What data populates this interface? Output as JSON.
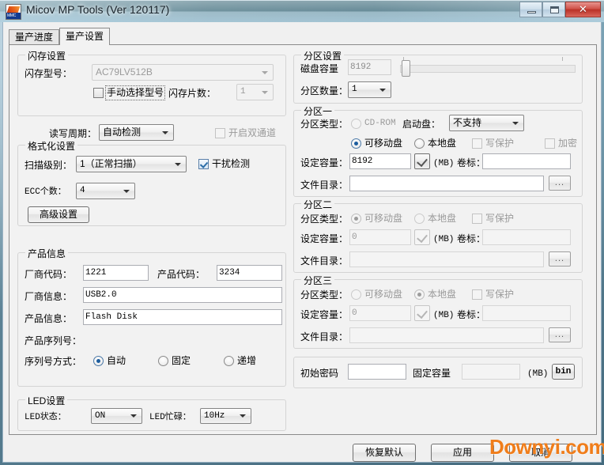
{
  "window": {
    "title": "Micov MP Tools (Ver 120117)",
    "icon": "app-icon",
    "minimize_label": "",
    "maximize_label": "",
    "close_label": "✕"
  },
  "tabs": [
    {
      "label": "量产进度",
      "active": false
    },
    {
      "label": "量产设置",
      "active": true
    }
  ],
  "flash_settings": {
    "title": "闪存设置",
    "model_label": "闪存型号：",
    "model_value": "AC79LV512B",
    "manual_select_label": "手动选择型号",
    "manual_select_checked": false,
    "chip_count_label": "闪存片数：",
    "chip_count_value": "1",
    "rw_cycle_label": "读写周期：",
    "rw_cycle_value": "自动检测",
    "dual_channel_label": "开启双通道",
    "dual_channel_checked": false
  },
  "format_settings": {
    "title": "格式化设置",
    "scan_level_label": "扫描级别：",
    "scan_level_value": "1（正常扫描）",
    "interference_label": "干扰检测",
    "interference_checked": true,
    "ecc_label": "ECC个数：",
    "ecc_value": "4",
    "advanced_button": "高级设置"
  },
  "product_info": {
    "title": "产品信息",
    "vendor_code_label": "厂商代码：",
    "vendor_code_value": "1221",
    "product_code_label": "产品代码：",
    "product_code_value": "3234",
    "vendor_info_label": "厂商信息：",
    "vendor_info_value": "USB2.0",
    "product_info_label": "产品信息：",
    "product_info_value": "Flash Disk",
    "serial_title_label": "产品序列号：",
    "serial_mode_label": "序列号方式：",
    "serial_modes": [
      {
        "label": "自动",
        "selected": true
      },
      {
        "label": "固定",
        "selected": false
      },
      {
        "label": "递增",
        "selected": false
      }
    ]
  },
  "led_settings": {
    "title": "LED设置",
    "state_label": "LED状态：",
    "state_value": "ON",
    "busy_label": "LED忙碌：",
    "busy_value": "10Hz"
  },
  "partition_settings": {
    "title": "分区设置",
    "disk_capacity_label": "磁盘容量",
    "disk_capacity_value": "8192",
    "partition_count_label": "分区数量：",
    "partition_count_value": "1",
    "slider_position_pct": 0
  },
  "partition_one": {
    "title": "分区一",
    "type_label": "分区类型：",
    "cdrom_label": "CD-ROM",
    "cdrom_selected": false,
    "boot_label": "启动盘：",
    "boot_value": "不支持",
    "removable_label": "可移动盘",
    "removable_selected": true,
    "local_label": "本地盘",
    "local_selected": false,
    "write_protect_label": "写保护",
    "write_protect_checked": false,
    "encrypt_label": "加密",
    "encrypt_checked": false,
    "capacity_label": "设定容量：",
    "capacity_value": "8192",
    "unit_label": "(MB)",
    "volume_label": "卷标：",
    "volume_value": "",
    "dir_label": "文件目录：",
    "dir_value": "",
    "browse_label": "..."
  },
  "partition_two": {
    "title": "分区二",
    "type_label": "分区类型：",
    "removable_label": "可移动盘",
    "removable_selected": true,
    "local_label": "本地盘",
    "local_selected": false,
    "write_protect_label": "写保护",
    "write_protect_checked": false,
    "capacity_label": "设定容量：",
    "capacity_value": "0",
    "unit_label": "(MB)",
    "volume_label": "卷标：",
    "volume_value": "",
    "dir_label": "文件目录：",
    "dir_value": "",
    "browse_label": "..."
  },
  "partition_three": {
    "title": "分区三",
    "type_label": "分区类型：",
    "removable_label": "可移动盘",
    "removable_selected": false,
    "local_label": "本地盘",
    "local_selected": true,
    "write_protect_label": "写保护",
    "write_protect_checked": false,
    "capacity_label": "设定容量：",
    "capacity_value": "0",
    "unit_label": "(MB)",
    "volume_label": "卷标：",
    "volume_value": "",
    "dir_label": "文件目录：",
    "dir_value": "",
    "browse_label": "..."
  },
  "password_bar": {
    "init_password_label": "初始密码",
    "init_password_value": "",
    "fixed_capacity_label": "固定容量",
    "fixed_capacity_value": "",
    "unit_label": "(MB)",
    "bin_button": "bin"
  },
  "footer": {
    "restore_defaults": "恢复默认",
    "apply": "应用",
    "cancel": "取消"
  },
  "watermark": {
    "text": "Downyi.com",
    "color": "#f07d1a"
  }
}
